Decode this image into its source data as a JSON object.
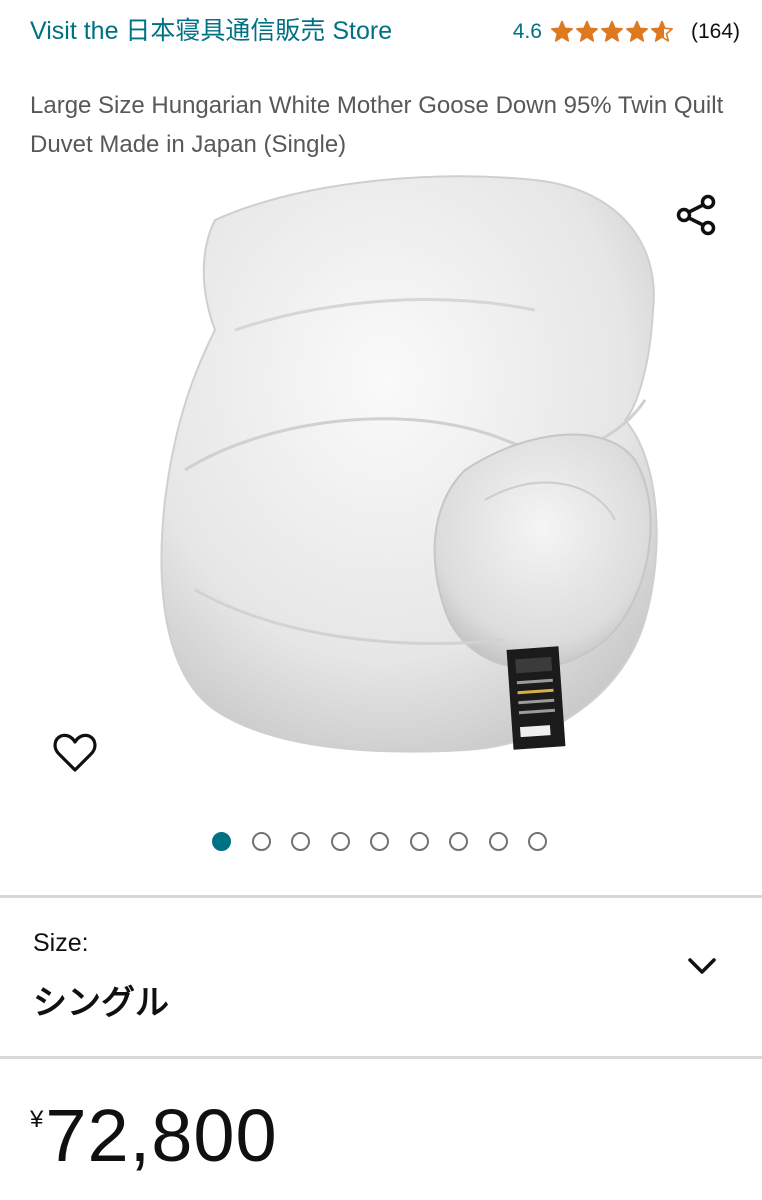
{
  "header": {
    "store_link": "Visit the 日本寝具通信販売 Store",
    "rating_value": "4.6",
    "rating_stars": 4.6,
    "review_count": "(164)",
    "title": "Large Size Hungarian White Mother Goose Down 95% Twin Quilt Duvet Made in Japan (Single)"
  },
  "gallery": {
    "share_icon": "share-icon",
    "wishlist_icon": "heart-outline-icon",
    "image_count": 9,
    "active_index": 0
  },
  "size": {
    "label": "Size:",
    "value": "シングル",
    "icon": "chevron-down-icon"
  },
  "price": {
    "currency": "¥",
    "amount": "72,800"
  },
  "colors": {
    "link": "#007185",
    "star": "#de7921",
    "text": "#0f1111",
    "secondary_text": "#565959",
    "divider": "#d5d9d9"
  }
}
